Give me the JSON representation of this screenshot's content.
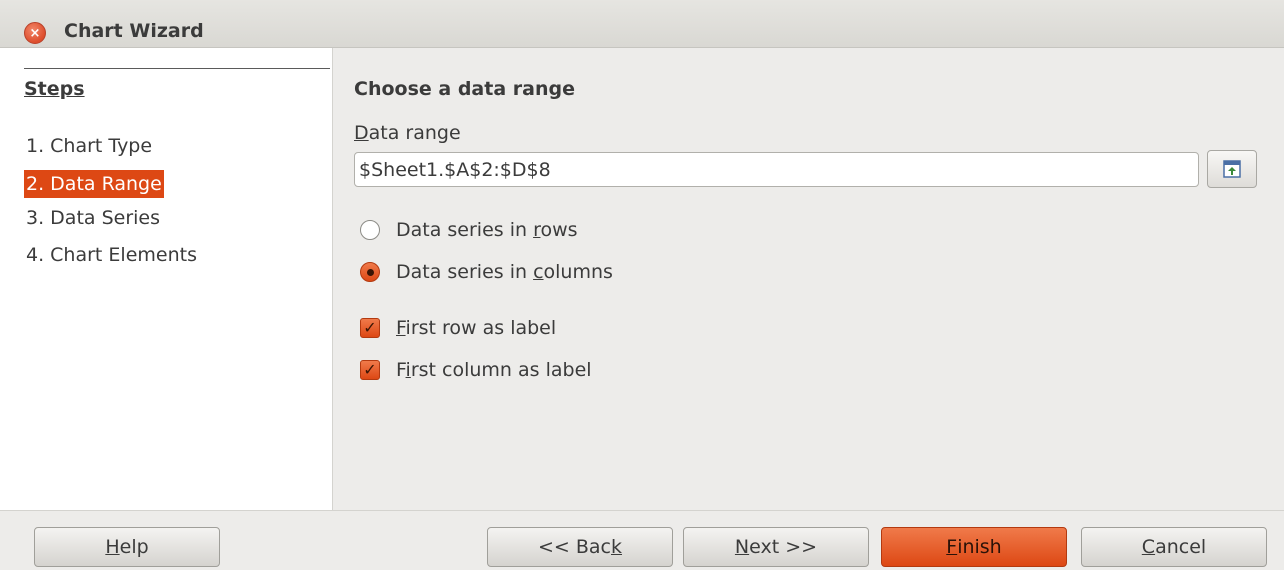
{
  "window": {
    "title": "Chart Wizard",
    "close_glyph": "×"
  },
  "steps": {
    "heading": "Steps",
    "items": [
      {
        "label": "1. Chart Type"
      },
      {
        "label": "2. Data Range",
        "active": true
      },
      {
        "label": "3. Data Series"
      },
      {
        "label": "4. Chart Elements"
      }
    ]
  },
  "main": {
    "title": "Choose a data range",
    "range_label": "Data range",
    "range_value": "$Sheet1.$A$2:$D$8",
    "shrink_icon": "shrink-dialog-icon",
    "radios": [
      {
        "label": "Data series in rows",
        "checked": false
      },
      {
        "label": "Data series in columns",
        "checked": true
      }
    ],
    "checks": [
      {
        "label": "First row as label",
        "checked": true
      },
      {
        "label": "First column as label",
        "checked": true
      }
    ]
  },
  "buttons": {
    "help": "Help",
    "back": "<< Back",
    "next": "Next >>",
    "finish": "Finish",
    "cancel": "Cancel"
  },
  "colors": {
    "accent": "#dd4814",
    "background": "#edecea"
  }
}
